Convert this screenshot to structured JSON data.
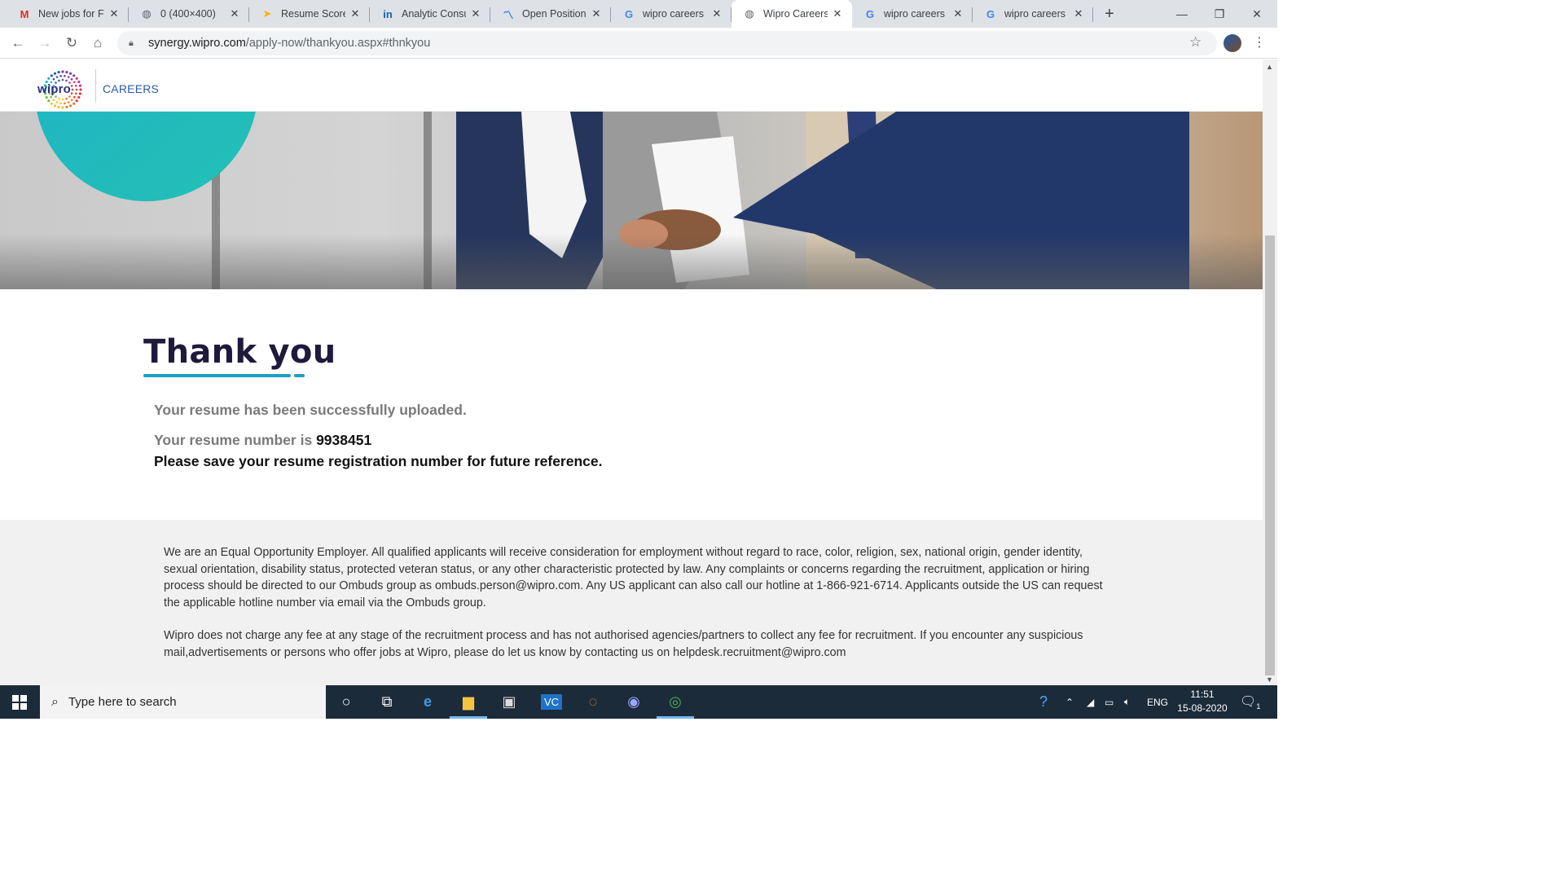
{
  "browser": {
    "tabs": [
      {
        "title": "New jobs for Fr",
        "icon": "gmail-icon",
        "icon_glyph": "M",
        "icon_color": "#d93025",
        "active": false
      },
      {
        "title": "0 (400×400)",
        "icon": "globe-icon",
        "icon_glyph": "◍",
        "icon_color": "#5f6368",
        "active": false
      },
      {
        "title": "Resume Score",
        "icon": "resume-score-icon",
        "icon_glyph": "➤",
        "icon_color": "#f4b400",
        "active": false
      },
      {
        "title": "Analytic Consul",
        "icon": "linkedin-icon",
        "icon_glyph": "in",
        "icon_color": "#0a66c2",
        "active": false
      },
      {
        "title": "Open Positions",
        "icon": "wave-icon",
        "icon_glyph": "〽",
        "icon_color": "#1a73e8",
        "active": false
      },
      {
        "title": "wipro careers -",
        "icon": "google-icon",
        "icon_glyph": "G",
        "icon_color": "#4285f4",
        "active": false
      },
      {
        "title": "Wipro Careers |",
        "icon": "globe-icon",
        "icon_glyph": "◍",
        "icon_color": "#5f6368",
        "active": true
      },
      {
        "title": "wipro careers",
        "icon": "google-icon",
        "icon_glyph": "G",
        "icon_color": "#4285f4",
        "active": false
      },
      {
        "title": "wipro careers",
        "icon": "google-icon",
        "icon_glyph": "G",
        "icon_color": "#4285f4",
        "active": false
      }
    ],
    "url_host": "synergy.wipro.com",
    "url_path": "/apply-now/thankyou.aspx#thnkyou"
  },
  "site": {
    "logo_text": "wipro",
    "section_label": "CAREERS"
  },
  "confirmation": {
    "title": "Thank you",
    "uploaded_msg": "Your resume has been successfully uploaded.",
    "number_prefix": "Your resume number is",
    "resume_number": "9938451",
    "save_note": "Please save your resume registration number for future reference."
  },
  "footer": {
    "eeo_text": "We are an Equal Opportunity Employer. All qualified applicants will receive consideration for employment without regard to race, color, religion, sex, national origin, gender identity, sexual orientation, disability status, protected veteran status, or any other characteristic protected by law. Any complaints or concerns regarding the recruitment, application or hiring process should be directed to our Ombuds group as ombuds.person@wipro.com. Any US applicant can also call our hotline at 1-866-921-6714. Applicants outside the US can request the applicable hotline number via email via the Ombuds group.",
    "fee_text": "Wipro does not charge any fee at any stage of the recruitment process and has not authorised agencies/partners to collect any fee for recruitment. If you encounter any suspicious mail,advertisements or persons who offer jobs at Wipro, please do let us know by contacting us on helpdesk.recruitment@wipro.com"
  },
  "taskbar": {
    "search_placeholder": "Type here to search",
    "language": "ENG",
    "time": "11:51",
    "date": "15-08-2020",
    "notification_count": "1"
  },
  "colors": {
    "accent_teal": "#1c9fc2",
    "title_navy": "#1f1a3c",
    "careers_blue": "#2b5aa8"
  }
}
